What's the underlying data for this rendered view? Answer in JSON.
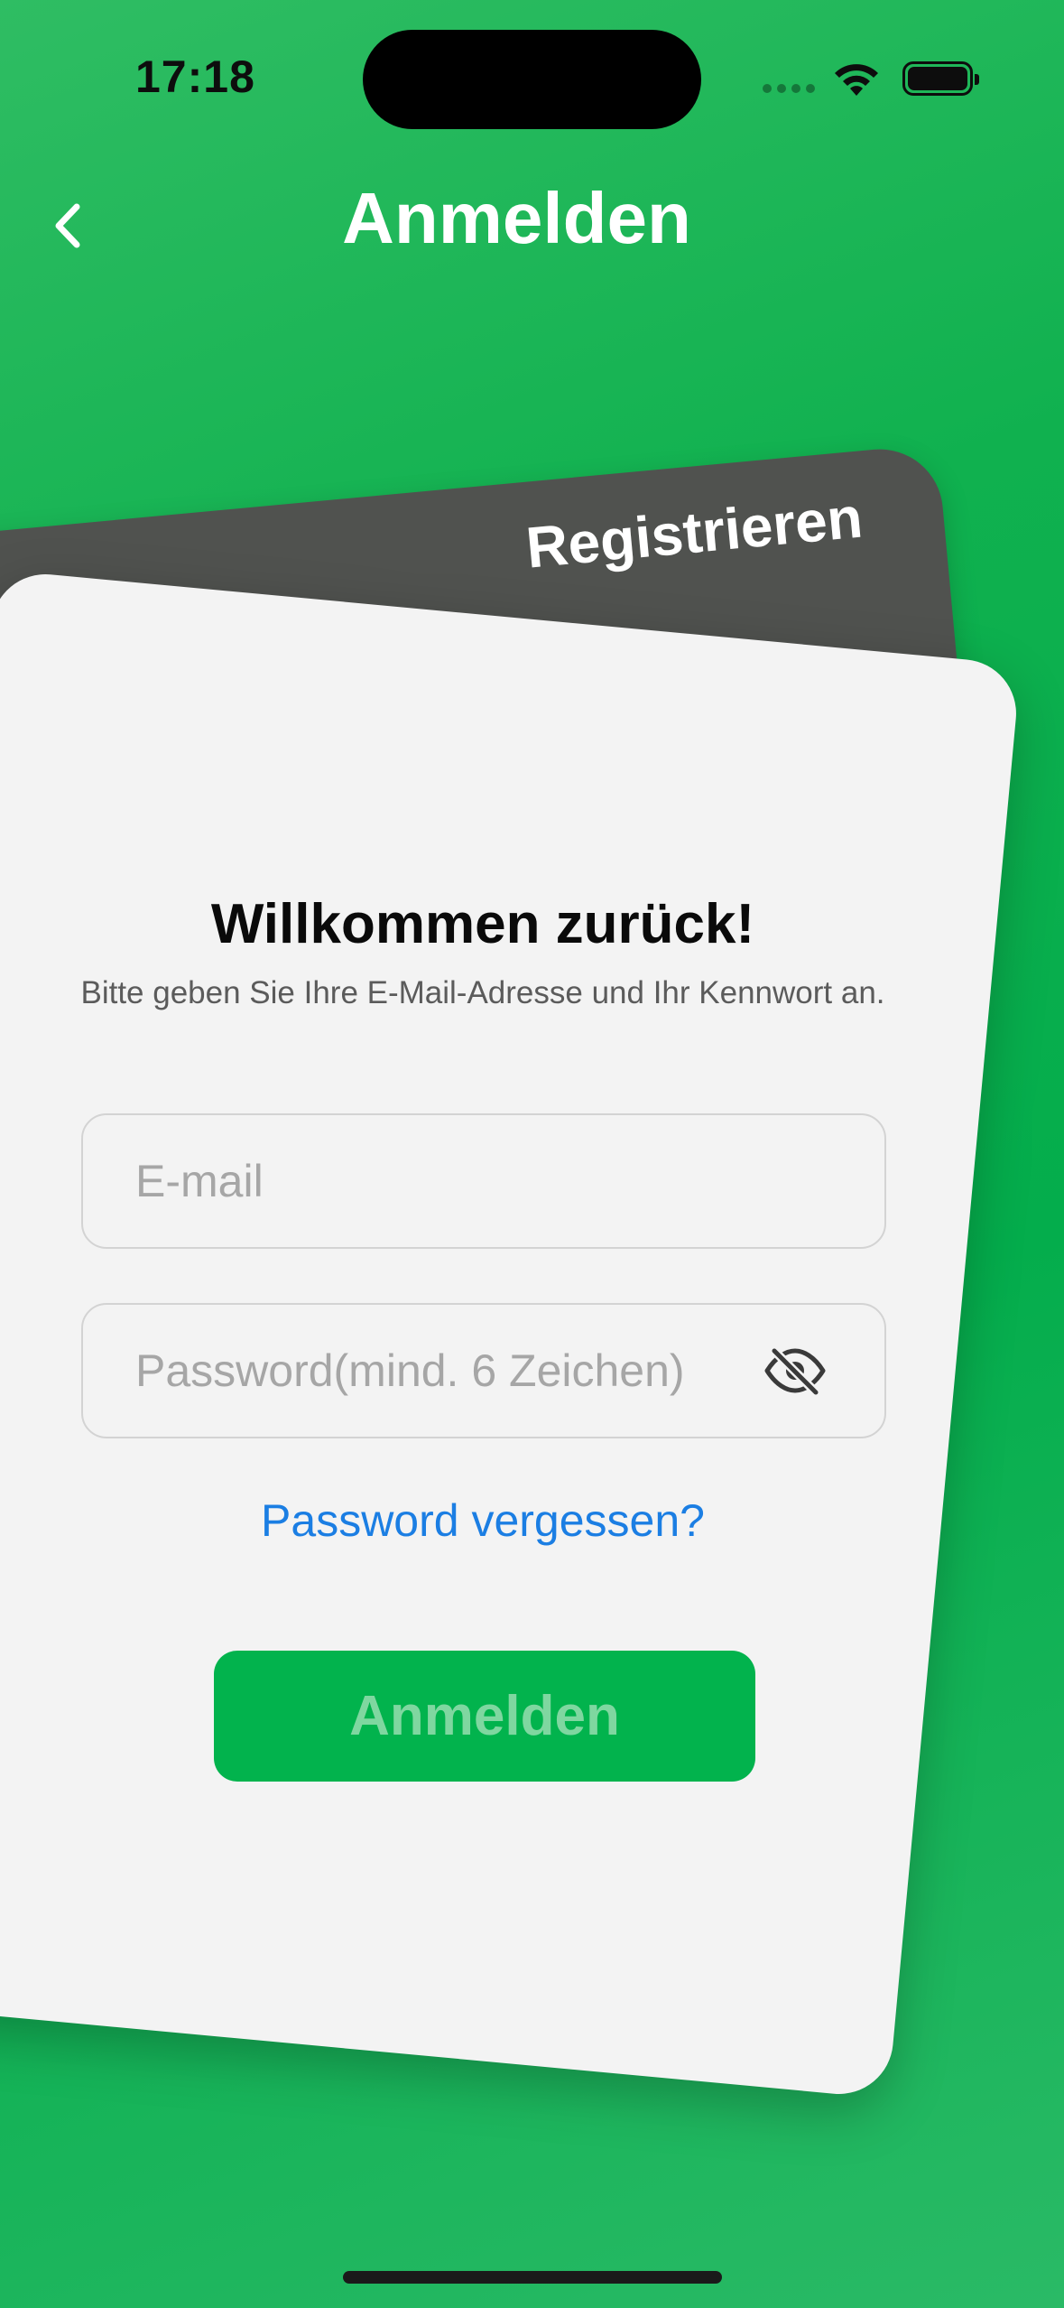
{
  "status_bar": {
    "time": "17:18"
  },
  "nav": {
    "title": "Anmelden",
    "back_icon": "chevron-left-icon"
  },
  "tabs": {
    "register": "Registrieren"
  },
  "login": {
    "title": "Willkommen zurück!",
    "subtitle": "Bitte geben Sie Ihre E-Mail-Adresse und Ihr Kennwort an.",
    "email_placeholder": "E-mail",
    "email_value": "",
    "password_placeholder": "Password(mind. 6 Zeichen)",
    "password_value": "",
    "forgot_password": "Password vergessen?",
    "submit_label": "Anmelden"
  },
  "colors": {
    "background": "#10b14f",
    "accent_green": "#02b34d",
    "button_text_disabled": "#7fd7a0",
    "link_blue": "#1b7ee3",
    "card_light": "#f3f3f3",
    "card_dark": "#50524f"
  }
}
